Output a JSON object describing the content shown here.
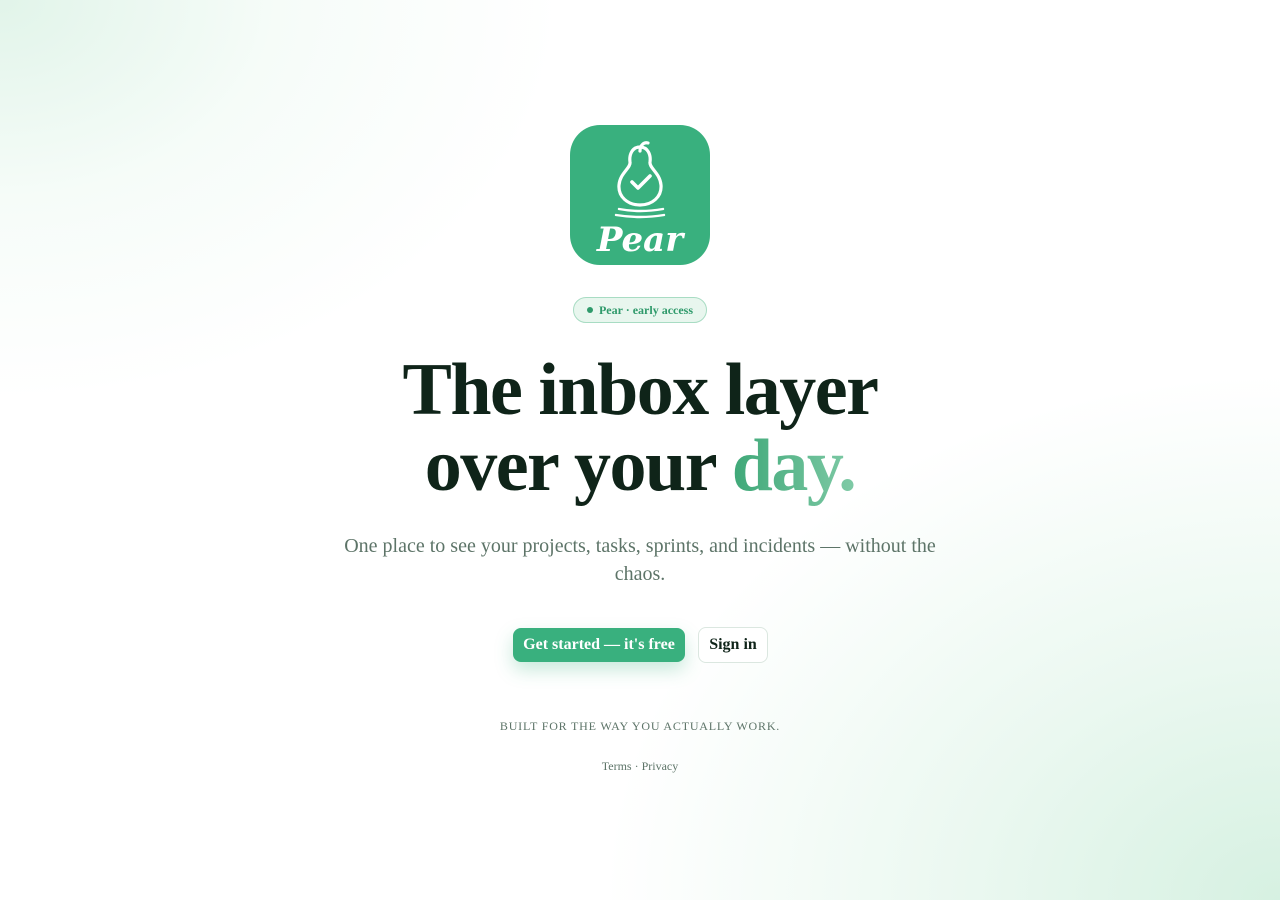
{
  "brand": {
    "logo_text": "Pear",
    "primary_color": "#39b07e",
    "text_color": "#0f2419",
    "muted_color": "#5d7468",
    "logo_icon": "pear-check-icon"
  },
  "badge": {
    "label": "Pear · early access"
  },
  "hero": {
    "headline_line1": "The inbox layer",
    "headline_line2_prefix": "over your ",
    "headline_line2_accent": "day.",
    "subhead": "One place to see your projects, tasks, sprints, and incidents — without the chaos."
  },
  "actions": {
    "primary_label": "Get started — it's free",
    "secondary_label": "Sign in"
  },
  "tagline": "BUILT FOR THE WAY YOU ACTUALLY WORK.",
  "footer": {
    "terms_label": "Terms",
    "separator": "·",
    "privacy_label": "Privacy"
  }
}
